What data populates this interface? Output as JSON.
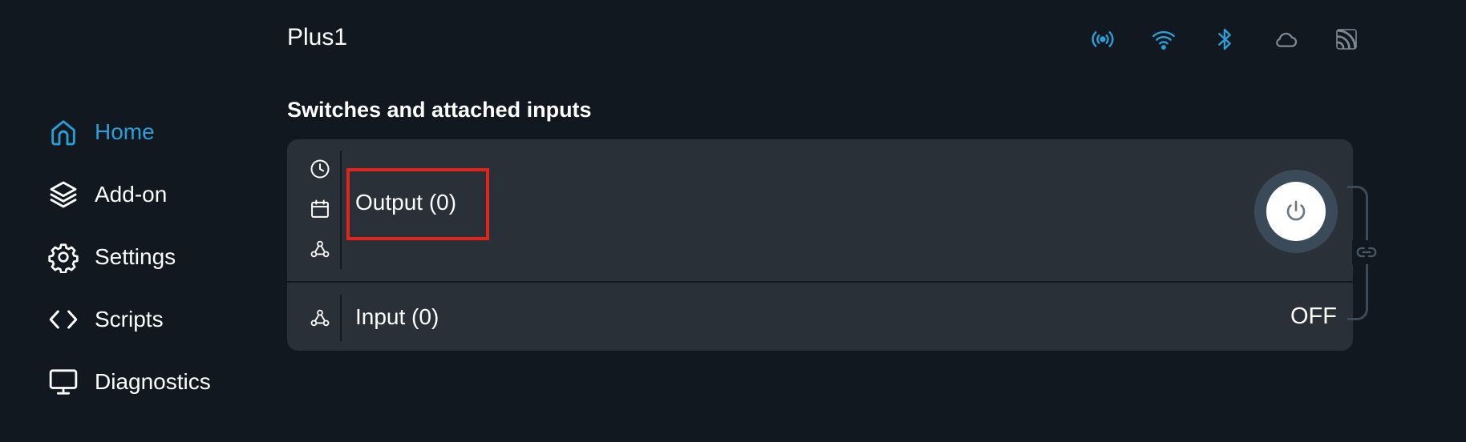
{
  "sidebar": {
    "items": [
      {
        "label": "Home",
        "icon": "home-icon",
        "active": true
      },
      {
        "label": "Add-on",
        "icon": "layers-icon",
        "active": false
      },
      {
        "label": "Settings",
        "icon": "gear-icon",
        "active": false
      },
      {
        "label": "Scripts",
        "icon": "code-icon",
        "active": false
      },
      {
        "label": "Diagnostics",
        "icon": "monitor-icon",
        "active": false
      }
    ]
  },
  "header": {
    "device_name": "Plus1",
    "status_icons": [
      "broadcast-icon",
      "wifi-icon",
      "bluetooth-icon",
      "cloud-icon",
      "rss-icon"
    ]
  },
  "section": {
    "title": "Switches and attached inputs"
  },
  "output": {
    "label": "Output (0)",
    "icons": [
      "clock-icon",
      "calendar-icon",
      "webhook-icon"
    ],
    "power_icon": "power-icon"
  },
  "input": {
    "label": "Input (0)",
    "state": "OFF",
    "icon": "webhook-icon"
  },
  "colors": {
    "background": "#111820",
    "card": "#2a3038",
    "accent": "#2a9fd6",
    "highlight": "#e0261b"
  }
}
